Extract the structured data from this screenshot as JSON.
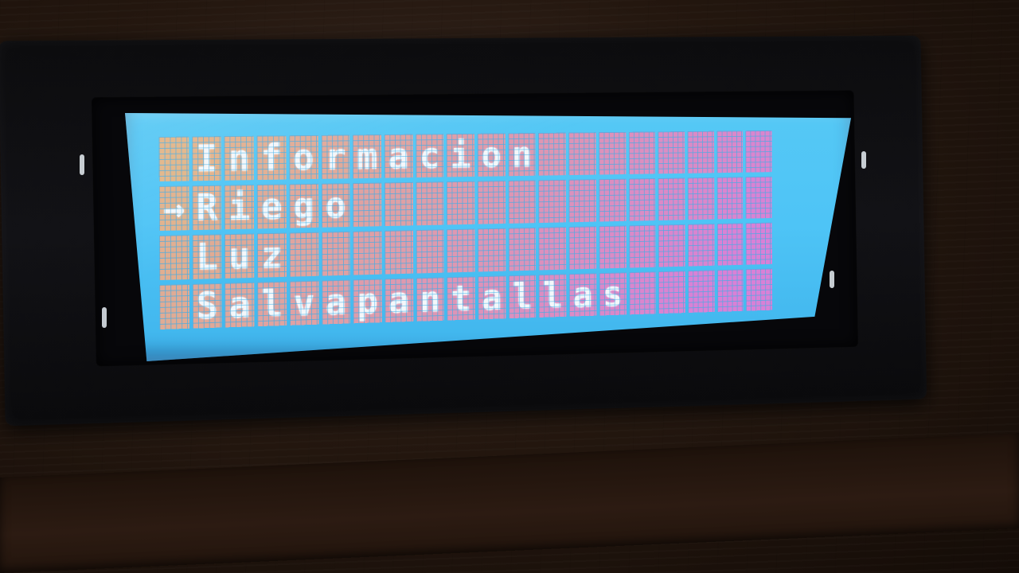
{
  "display": {
    "columns": 20,
    "rows": 4,
    "lines": [
      " Informacion        ",
      "→Riego              ",
      " Luz                ",
      " Salvapantallas     "
    ],
    "backlight_color": "#4ec4f6",
    "pixel_gradient_left": "#e2b486",
    "pixel_gradient_right": "#d980d6",
    "text_color": "#f4f7fa"
  },
  "menu": {
    "items": [
      {
        "label": "Informacion",
        "selected": false
      },
      {
        "label": "Riego",
        "selected": true
      },
      {
        "label": "Luz",
        "selected": false
      },
      {
        "label": "Salvapantallas",
        "selected": false
      }
    ],
    "cursor_glyph": "→"
  }
}
